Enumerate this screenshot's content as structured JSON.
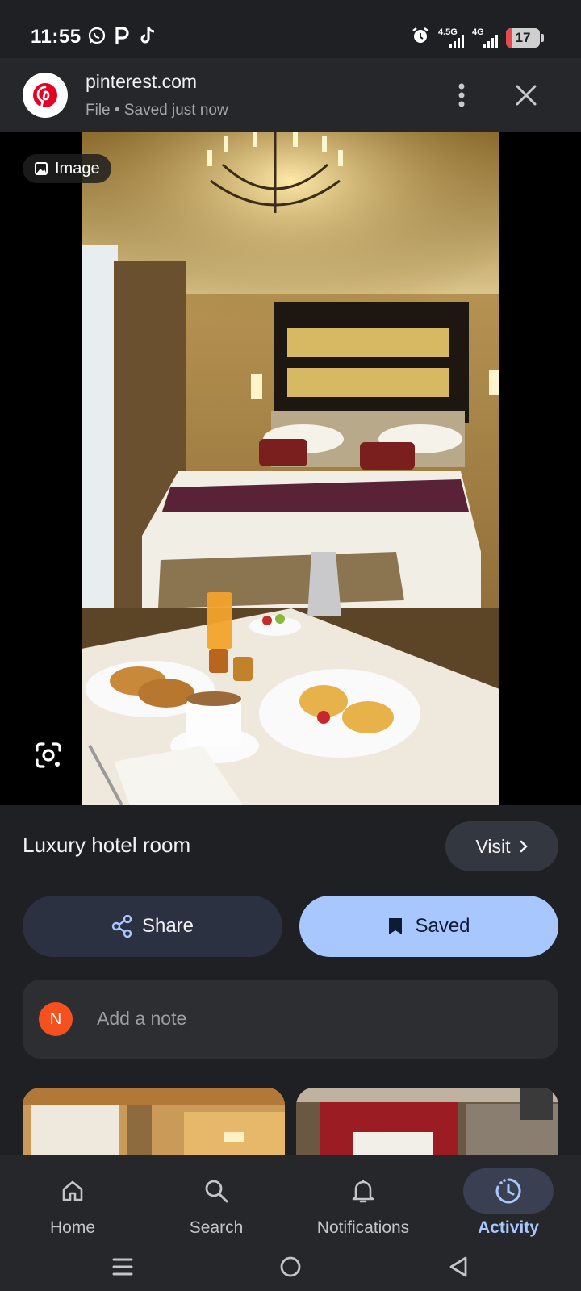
{
  "status_bar": {
    "time": "11:55",
    "app_icons": [
      "whatsapp-icon",
      "parking-app-icon",
      "tiktok-icon"
    ],
    "network_1": "4.5G",
    "network_2": "4G",
    "battery": "17",
    "battery_level_percent": 17,
    "colors": {
      "battery_low": "#e5484d"
    }
  },
  "source": {
    "site": "pinterest.com",
    "subtitle": "File • Saved just now",
    "logo_icon": "pinterest-logo",
    "brand_color": "#e60023"
  },
  "image": {
    "chip_label": "Image",
    "chip_icon": "image-icon",
    "lens_icon": "google-lens-icon"
  },
  "detail": {
    "title": "Luxury hotel room",
    "visit_label": "Visit",
    "share_label": "Share",
    "saved_label": "Saved",
    "note_avatar_initial": "N",
    "note_placeholder": "Add a note",
    "accent_color": "#a9c7ff"
  },
  "bottom_nav": {
    "items": [
      {
        "label": "Home",
        "icon": "home-icon"
      },
      {
        "label": "Search",
        "icon": "search-icon"
      },
      {
        "label": "Notifications",
        "icon": "bell-icon"
      },
      {
        "label": "Activity",
        "icon": "activity-icon",
        "active": true
      }
    ]
  },
  "system_nav": {
    "buttons": [
      "recents-icon",
      "home-circle-icon",
      "back-icon"
    ]
  }
}
